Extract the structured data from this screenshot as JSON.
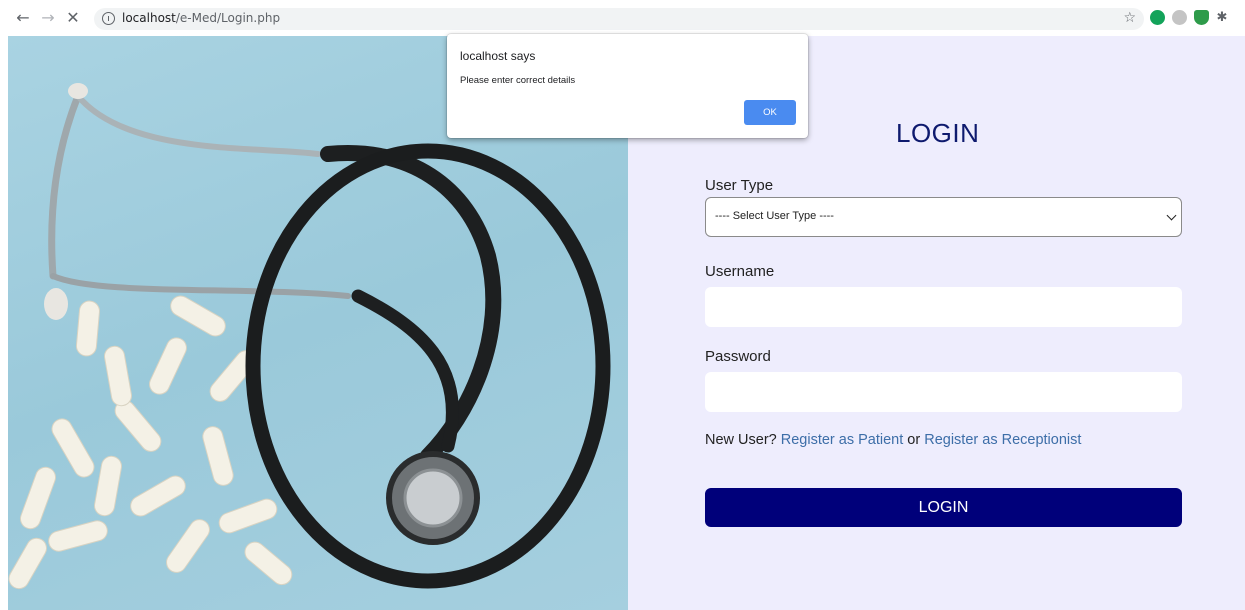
{
  "browser": {
    "url_host": "localhost",
    "url_path": "/e-Med/Login.php",
    "back_icon": "arrow-left-icon",
    "forward_icon": "arrow-right-icon",
    "stop_icon": "close-icon"
  },
  "dialog": {
    "title": "localhost says",
    "message": "Please enter correct details",
    "ok_label": "OK"
  },
  "login": {
    "heading": "LOGIN",
    "user_type_label": "User Type",
    "user_type_selected": "---- Select User Type ----",
    "username_label": "Username",
    "username_value": "",
    "password_label": "Password",
    "password_value": "",
    "new_user_text": "New User?",
    "register_patient": "Register as Patient",
    "or_text": "or",
    "register_receptionist": "Register as Receptionist",
    "submit_label": "LOGIN"
  },
  "colors": {
    "panel_bg": "#eeedfd",
    "title_color": "#0e1a6e",
    "button_bg": "#00007a",
    "link_color": "#3d6ea8",
    "hero_bg": "#a9d3e2",
    "dialog_button": "#4a8bf0"
  }
}
